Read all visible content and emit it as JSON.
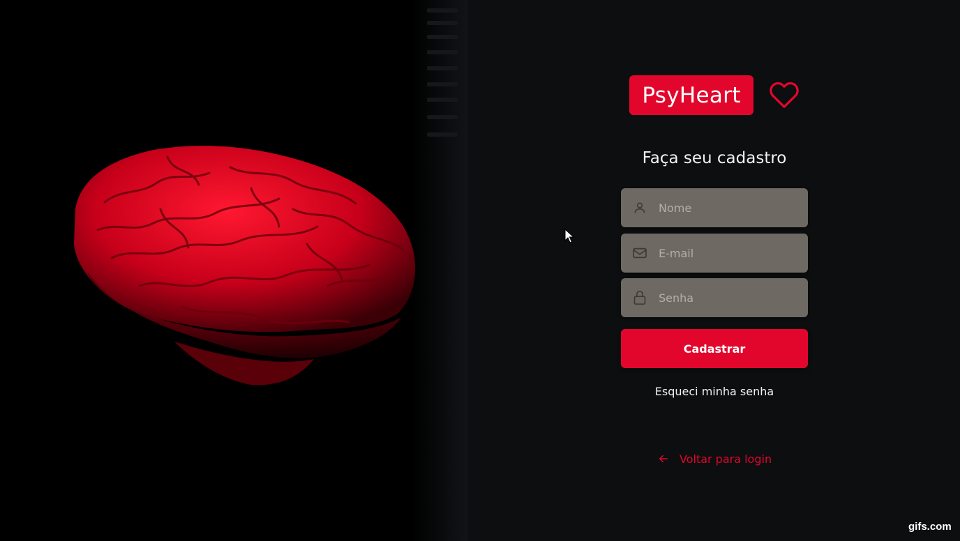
{
  "brand": {
    "name": "PsyHeart",
    "color": "#e3062c"
  },
  "hero": {
    "image": "red-brain-illustration"
  },
  "form": {
    "title": "Faça seu cadastro",
    "fields": [
      {
        "icon": "user-icon",
        "placeholder": "Nome",
        "value": ""
      },
      {
        "icon": "mail-icon",
        "placeholder": "E-mail",
        "value": ""
      },
      {
        "icon": "lock-icon",
        "placeholder": "Senha",
        "value": ""
      }
    ],
    "submit_label": "Cadastrar",
    "forgot_label": "Esqueci minha senha",
    "back_label": "Voltar para login"
  },
  "watermark": "gifs.com"
}
